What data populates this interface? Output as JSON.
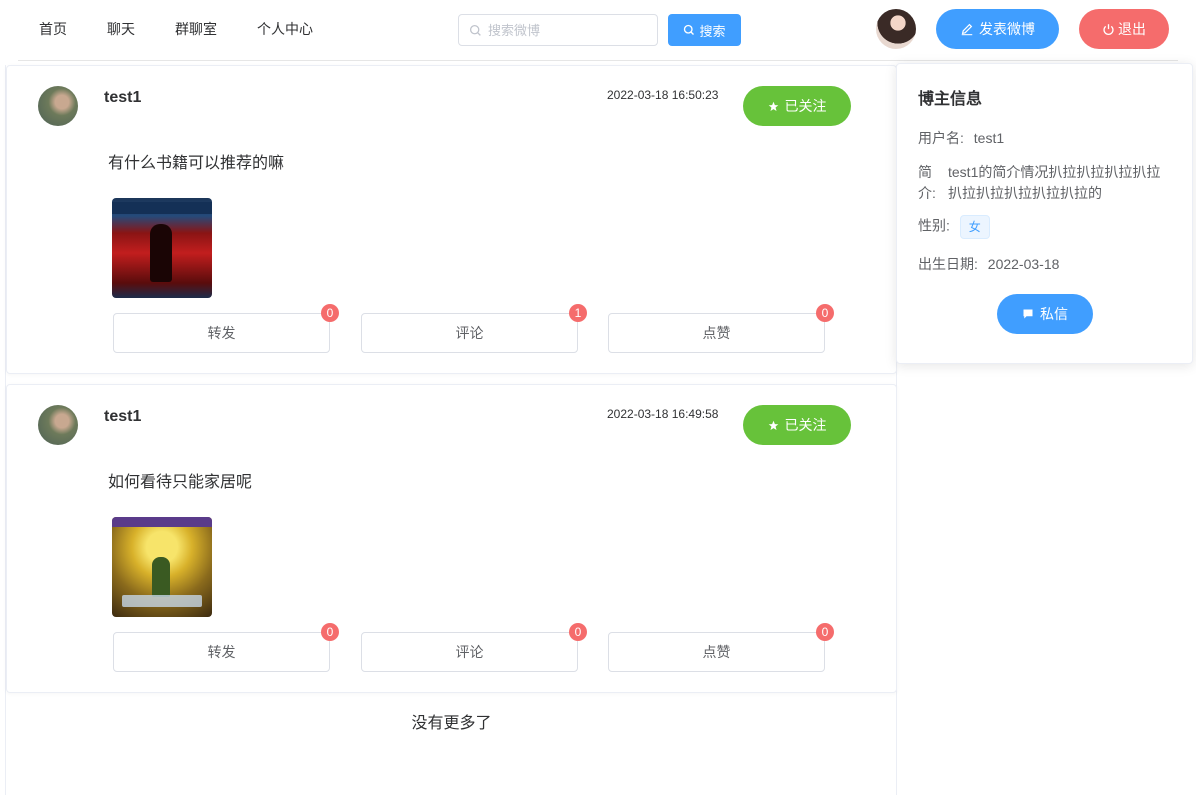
{
  "nav": {
    "items": [
      {
        "label": "首页"
      },
      {
        "label": "聊天"
      },
      {
        "label": "群聊室"
      },
      {
        "label": "个人中心"
      }
    ],
    "search_placeholder": "搜索微博",
    "search_button": "搜索",
    "post_button": "发表微博",
    "logout_button": "退出"
  },
  "posts": [
    {
      "username": "test1",
      "timestamp": "2022-03-18 16:50:23",
      "follow_label": "已关注",
      "content": "有什么书籍可以推荐的嘛",
      "actions": [
        {
          "label": "转发",
          "count": "0"
        },
        {
          "label": "评论",
          "count": "1"
        },
        {
          "label": "点赞",
          "count": "0"
        }
      ]
    },
    {
      "username": "test1",
      "timestamp": "2022-03-18 16:49:58",
      "follow_label": "已关注",
      "content": "如何看待只能家居呢",
      "actions": [
        {
          "label": "转发",
          "count": "0"
        },
        {
          "label": "评论",
          "count": "0"
        },
        {
          "label": "点赞",
          "count": "0"
        }
      ]
    }
  ],
  "no_more": "没有更多了",
  "blogger": {
    "title": "博主信息",
    "username_label": "用户名:",
    "username": "test1",
    "intro_label": "简介:",
    "intro": "test1的简介情况扒拉扒拉扒拉扒拉扒拉扒拉扒拉扒拉扒拉的",
    "gender_label": "性别:",
    "gender": "女",
    "birth_label": "出生日期:",
    "birth": "2022-03-18",
    "dm_button": "私信"
  },
  "colors": {
    "primary": "#409eff",
    "success": "#67c23a",
    "danger": "#f56c6c"
  },
  "icons": {
    "search": "search-icon",
    "edit": "edit-icon",
    "power": "power-icon",
    "star": "star-icon",
    "message": "message-icon"
  }
}
